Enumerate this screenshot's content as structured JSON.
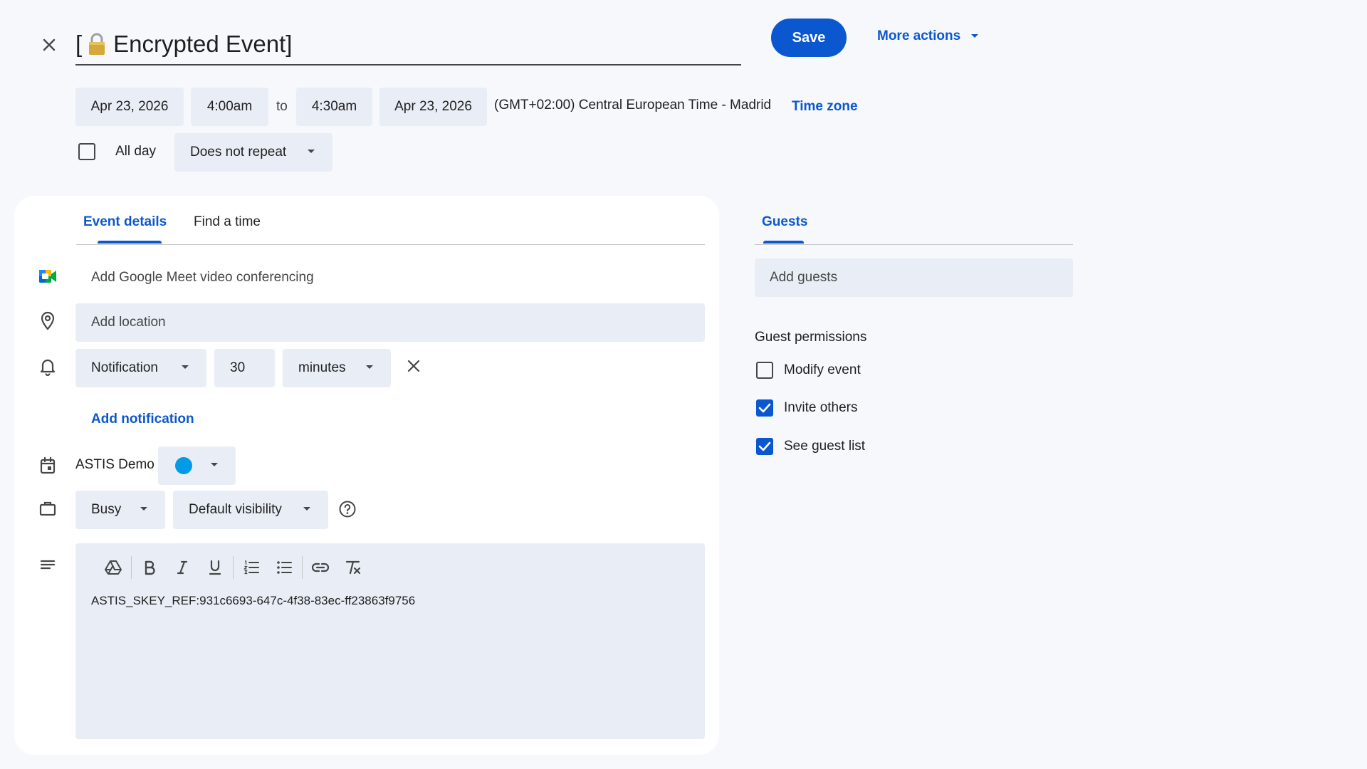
{
  "header": {
    "title_prefix": "[",
    "title": "Encrypted Event]",
    "lock_icon": "lock-icon",
    "save_label": "Save",
    "more_actions_label": "More actions"
  },
  "datetime": {
    "start_date": "Apr 23, 2026",
    "start_time": "4:00am",
    "to_label": "to",
    "end_time": "4:30am",
    "end_date": "Apr 23, 2026",
    "timezone_text": "(GMT+02:00) Central European Time - Madrid",
    "timezone_link": "Time zone",
    "all_day_label": "All day",
    "all_day_checked": false,
    "repeat": "Does not repeat"
  },
  "tabs": {
    "event_details": "Event details",
    "find_a_time": "Find a time",
    "active": "event_details"
  },
  "details": {
    "meet_label": "Add Google Meet video conferencing",
    "location_placeholder": "Add location",
    "notification": {
      "type": "Notification",
      "value": "30",
      "unit": "minutes"
    },
    "add_notification_label": "Add notification",
    "calendar_name": "ASTIS Demo",
    "calendar_color": "#039be5",
    "busy_status": "Busy",
    "visibility": "Default visibility",
    "description": "ASTIS_SKEY_REF:931c6693-647c-4f38-83ec-ff23863f9756"
  },
  "guests": {
    "tab_label": "Guests",
    "add_placeholder": "Add guests",
    "permissions_title": "Guest permissions",
    "permissions": [
      {
        "label": "Modify event",
        "checked": false
      },
      {
        "label": "Invite others",
        "checked": true
      },
      {
        "label": "See guest list",
        "checked": true
      }
    ]
  },
  "colors": {
    "accent": "#0b57d0",
    "field_bg": "#e9eef6",
    "page_bg": "#f6f8fc"
  }
}
